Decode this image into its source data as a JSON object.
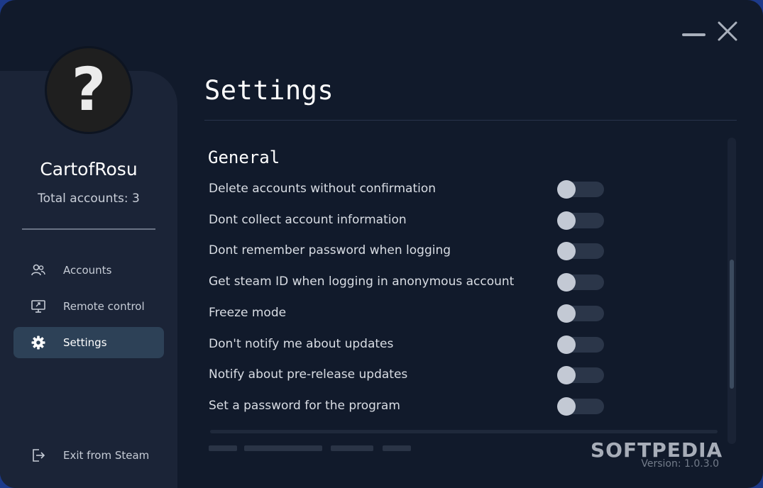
{
  "profile": {
    "username": "CartofRosu",
    "total_accounts": "Total accounts: 3",
    "avatar_glyph": "?"
  },
  "sidebar": {
    "items": [
      {
        "label": "Accounts",
        "icon": "people-icon",
        "active": false
      },
      {
        "label": "Remote control",
        "icon": "monitor-icon",
        "active": false
      },
      {
        "label": "Settings",
        "icon": "gear-icon",
        "active": true
      }
    ],
    "exit_label": "Exit from Steam"
  },
  "main": {
    "title": "Settings",
    "section_title": "General",
    "settings": [
      {
        "label": "Delete accounts without confirmation",
        "enabled": false
      },
      {
        "label": "Dont collect account information",
        "enabled": false
      },
      {
        "label": "Dont remember password when logging",
        "enabled": false
      },
      {
        "label": "Get steam ID when logging in anonymous account",
        "enabled": false
      },
      {
        "label": "Freeze mode",
        "enabled": false
      },
      {
        "label": "Don't notify me about updates",
        "enabled": false
      },
      {
        "label": "Notify about pre-release updates",
        "enabled": false
      },
      {
        "label": "Set a password for the program",
        "enabled": false
      }
    ],
    "version": "Version: 1.0.3.0"
  },
  "watermark": "SOFTPEDIA",
  "colors": {
    "background": "#111a2b",
    "sidebar": "#1b2437",
    "active_item": "#2d4157",
    "toggle_off_track": "#2b3649",
    "toggle_knob": "#c3c9d4"
  }
}
